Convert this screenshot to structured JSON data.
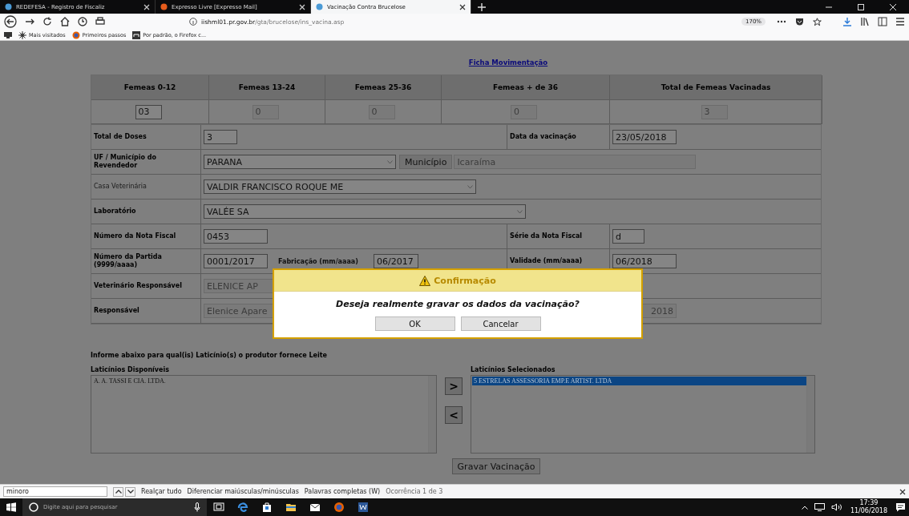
{
  "browser": {
    "tabs": [
      {
        "title": "REDEFESA - Registro de Fiscaliz",
        "selected": false
      },
      {
        "title": "Expresso Livre [Expresso Mail]",
        "selected": false
      },
      {
        "title": "Vacinação Contra Brucelose",
        "selected": true
      }
    ],
    "url_host": "iishml01.pr.gov.br",
    "url_path": "/gta/brucelose/ins_vacina.asp",
    "zoom": "170%",
    "bookmarks": [
      "Mais visitados",
      "Primeiros passos",
      "Por padrão, o Firefox c..."
    ]
  },
  "page": {
    "link": "Ficha Movimentação",
    "femeas": [
      {
        "column": "Femeas 0-12",
        "value": "03",
        "disabled": false
      },
      {
        "column": "Femeas 13-24",
        "value": "0",
        "disabled": true
      },
      {
        "column": "Femeas 25-36",
        "value": "0",
        "disabled": true
      },
      {
        "column": "Femeas + de 36",
        "value": "0",
        "disabled": true
      },
      {
        "column": "Total de Femeas Vacinadas",
        "value": "3",
        "disabled": true
      }
    ],
    "rows": [
      {
        "label": "Total de Doses",
        "bold": true,
        "fields": [
          {
            "kind": "input",
            "value": "3"
          }
        ],
        "right_label": "Data da vacinação",
        "right_fields": [
          {
            "kind": "input",
            "value": "23/05/2018"
          }
        ]
      },
      {
        "label": "UF / Município do Revendedor",
        "bold": true,
        "fields": [
          {
            "kind": "select",
            "value": "PARANA"
          },
          {
            "kind": "button",
            "value": "Município"
          },
          {
            "kind": "readonly",
            "value": "Icaraíma"
          }
        ]
      },
      {
        "label": "Casa Veterinária",
        "bold": false,
        "fields": [
          {
            "kind": "select",
            "value": "VALDIR FRANCISCO ROQUE ME"
          }
        ]
      },
      {
        "label": "Laboratório",
        "bold": true,
        "fields": [
          {
            "kind": "select",
            "value": "VALÉE SA"
          }
        ]
      },
      {
        "label": "Número da Nota Fiscal",
        "bold": true,
        "fields": [
          {
            "kind": "input",
            "value": "0453"
          }
        ],
        "right_label": "Série da Nota Fiscal",
        "right_fields": [
          {
            "kind": "input",
            "value": "d"
          }
        ]
      },
      {
        "label": "Número da Partida (9999/aaaa)",
        "bold": true,
        "fields": [
          {
            "kind": "input",
            "value": "0001/2017"
          },
          {
            "kind": "label",
            "value": "Fabricação (mm/aaaa)"
          },
          {
            "kind": "input",
            "value": "06/2017"
          }
        ],
        "right_label": "Validade (mm/aaaa)",
        "right_fields": [
          {
            "kind": "input",
            "value": "06/2018"
          }
        ]
      },
      {
        "label": "Veterinário Responsável",
        "bold": true,
        "fields": [
          {
            "kind": "readonly",
            "value": "ELENICE AP"
          }
        ]
      },
      {
        "label": "Responsável",
        "bold": true,
        "fields": [
          {
            "kind": "readonly",
            "value": "Elenice Apare"
          }
        ],
        "right_fields": [
          {
            "kind": "readonly",
            "value": "2018"
          }
        ]
      }
    ],
    "laticinios_intro": "Informe abaixo para qual(is) Laticínio(s) o produtor fornece Leite",
    "available": {
      "title": "Laticínios Disponíveis",
      "items": [
        {
          "text": "A. A. TASSI E CIA. LTDA.",
          "selected": false
        }
      ]
    },
    "move_buttons": [
      ">",
      "<"
    ],
    "chosen": {
      "title": "Laticínios Selecionados",
      "items": [
        {
          "text": "5 ESTRELAS ASSESSORIA EMP.E ARTIST. LTDA",
          "selected": true
        }
      ]
    },
    "save_button": "Gravar Vacinação"
  },
  "dialog": {
    "title": "Confirmação",
    "message": "Deseja realmente gravar os dados da vacinação?",
    "buttons": [
      "OK",
      "Cancelar"
    ]
  },
  "find_bar": {
    "query": "minoro",
    "options": [
      "Realçar tudo",
      "Diferenciar maiúsculas/minúsculas",
      "Palavras completas (W)"
    ],
    "status": "Ocorrência 1 de 3"
  },
  "taskbar": {
    "search_placeholder": "Digite aqui para pesquisar",
    "time": "17:39",
    "date": "11/06/2018"
  }
}
